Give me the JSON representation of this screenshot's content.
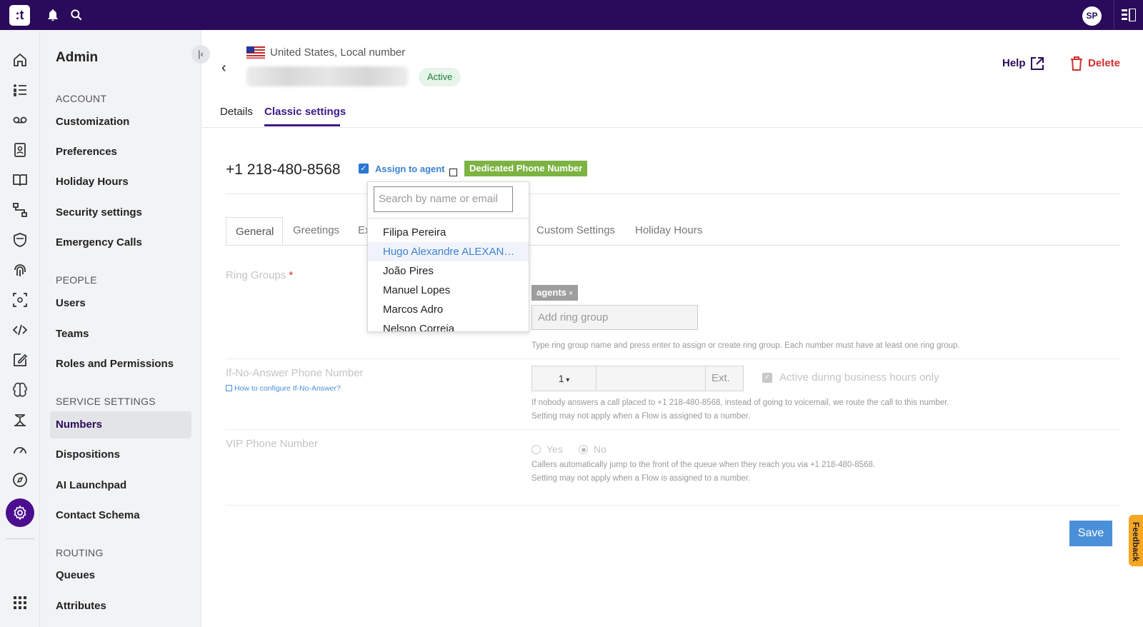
{
  "app": {
    "logo": ":t",
    "user_initials": "SP"
  },
  "sidebar": {
    "title": "Admin",
    "sections": [
      {
        "label": "ACCOUNT",
        "items": [
          "Customization",
          "Preferences",
          "Holiday Hours",
          "Security settings",
          "Emergency Calls"
        ]
      },
      {
        "label": "PEOPLE",
        "items": [
          "Users",
          "Teams",
          "Roles and Permissions"
        ]
      },
      {
        "label": "SERVICE SETTINGS",
        "items": [
          "Numbers",
          "Dispositions",
          "AI Launchpad",
          "Contact Schema"
        ]
      },
      {
        "label": "ROUTING",
        "items": [
          "Queues",
          "Attributes"
        ]
      }
    ],
    "active_item": "Numbers"
  },
  "header": {
    "country": "United States, Local number",
    "status": "Active",
    "help_label": "Help",
    "delete_label": "Delete",
    "tabs": [
      "Details",
      "Classic settings"
    ],
    "active_tab": "Classic settings"
  },
  "number_row": {
    "phone": "+1 218-480-8568",
    "assign_label": "Assign to agent",
    "assign_checked": true,
    "badge": "Dedicated Phone Number"
  },
  "subtabs": [
    "General",
    "Greetings",
    "Ex",
    "Custom Settings",
    "Holiday Hours"
  ],
  "dropdown": {
    "search_placeholder": "Search by name or email",
    "items": [
      "Filipa Pereira",
      "Hugo Alexandre ALEXAN…",
      "João Pires",
      "Manuel Lopes",
      "Marcos Adro",
      "Nelson Correia"
    ],
    "hovered": "Hugo Alexandre ALEXAN…"
  },
  "form": {
    "ring_groups_label": "Ring Groups",
    "ring_group_tag": "agents",
    "ring_group_placeholder": "Add ring group",
    "ring_group_hint": "Type ring group name and press enter to assign or create ring group. Each number must have at least one ring group.",
    "ifna_label": "If-No-Answer Phone Number",
    "ifna_howto": "How to configure If-No-Answer?",
    "country_code": "1",
    "ext_placeholder": "Ext.",
    "active_hours_label": "Active during business hours only",
    "ifna_hint_1": "If nobody answers a call placed to +1 218-480-8568, instead of going to voicemail, we route the call to this number.",
    "ifna_hint_2": "Setting may not apply when a Flow is assigned to a number.",
    "vip_label": "VIP Phone Number",
    "vip_yes": "Yes",
    "vip_no": "No",
    "vip_hint_1": "Callers automatically jump to the front of the queue when they reach you via +1 218-480-8568.",
    "vip_hint_2": "Setting may not apply when a Flow is assigned to a number."
  },
  "actions": {
    "save": "Save",
    "feedback": "Feedback"
  },
  "colors": {
    "topbar": "#2a0a5a",
    "accent": "#3d1a8a",
    "link": "#3b82d0",
    "badge": "#7cb342",
    "delete": "#d32f2f",
    "save": "#4a90d9"
  }
}
